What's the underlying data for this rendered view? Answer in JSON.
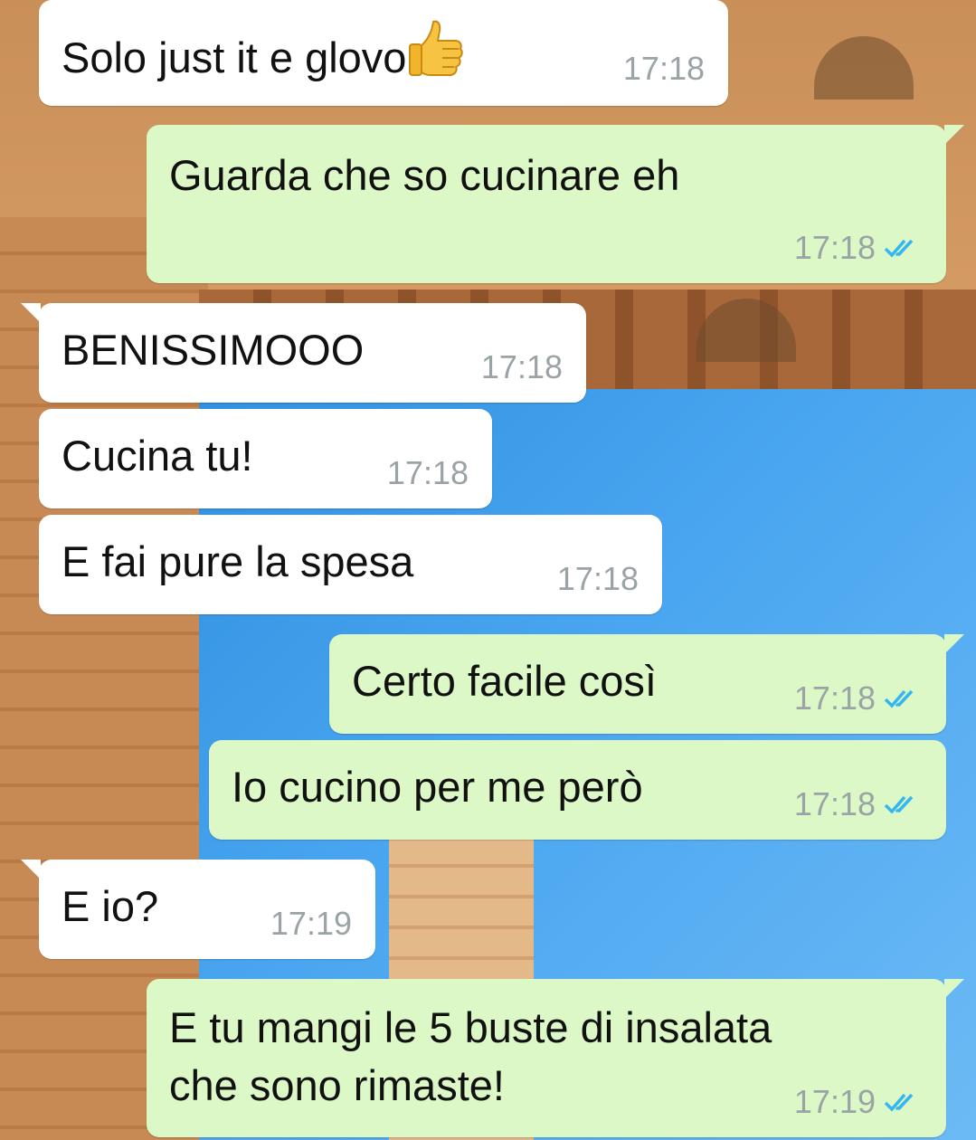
{
  "colors": {
    "incoming_bubble": "#ffffff",
    "outgoing_bubble": "#dcf8c6",
    "timestamp": "#9aa3a6",
    "read_ticks": "#34b7f1"
  },
  "messages": [
    {
      "direction": "incoming",
      "text": "Solo just it e glovo",
      "emoji": "thumbs-up-icon",
      "time": "17:18"
    },
    {
      "direction": "outgoing",
      "text": "Guarda che so cucinare eh",
      "time": "17:18",
      "status": "read"
    },
    {
      "direction": "incoming",
      "text": "BENISSIMOOO",
      "time": "17:18"
    },
    {
      "direction": "incoming",
      "text": "Cucina tu!",
      "time": "17:18"
    },
    {
      "direction": "incoming",
      "text": "E fai pure la spesa",
      "time": "17:18"
    },
    {
      "direction": "outgoing",
      "text": "Certo facile così",
      "time": "17:18",
      "status": "read"
    },
    {
      "direction": "outgoing",
      "text": "Io cucino per me però",
      "time": "17:18",
      "status": "read"
    },
    {
      "direction": "incoming",
      "text": "E io?",
      "time": "17:19"
    },
    {
      "direction": "outgoing",
      "text_line1": "E tu mangi le 5 buste di insalata",
      "text_line2": "che sono rimaste!",
      "time": "17:19",
      "status": "read"
    }
  ]
}
